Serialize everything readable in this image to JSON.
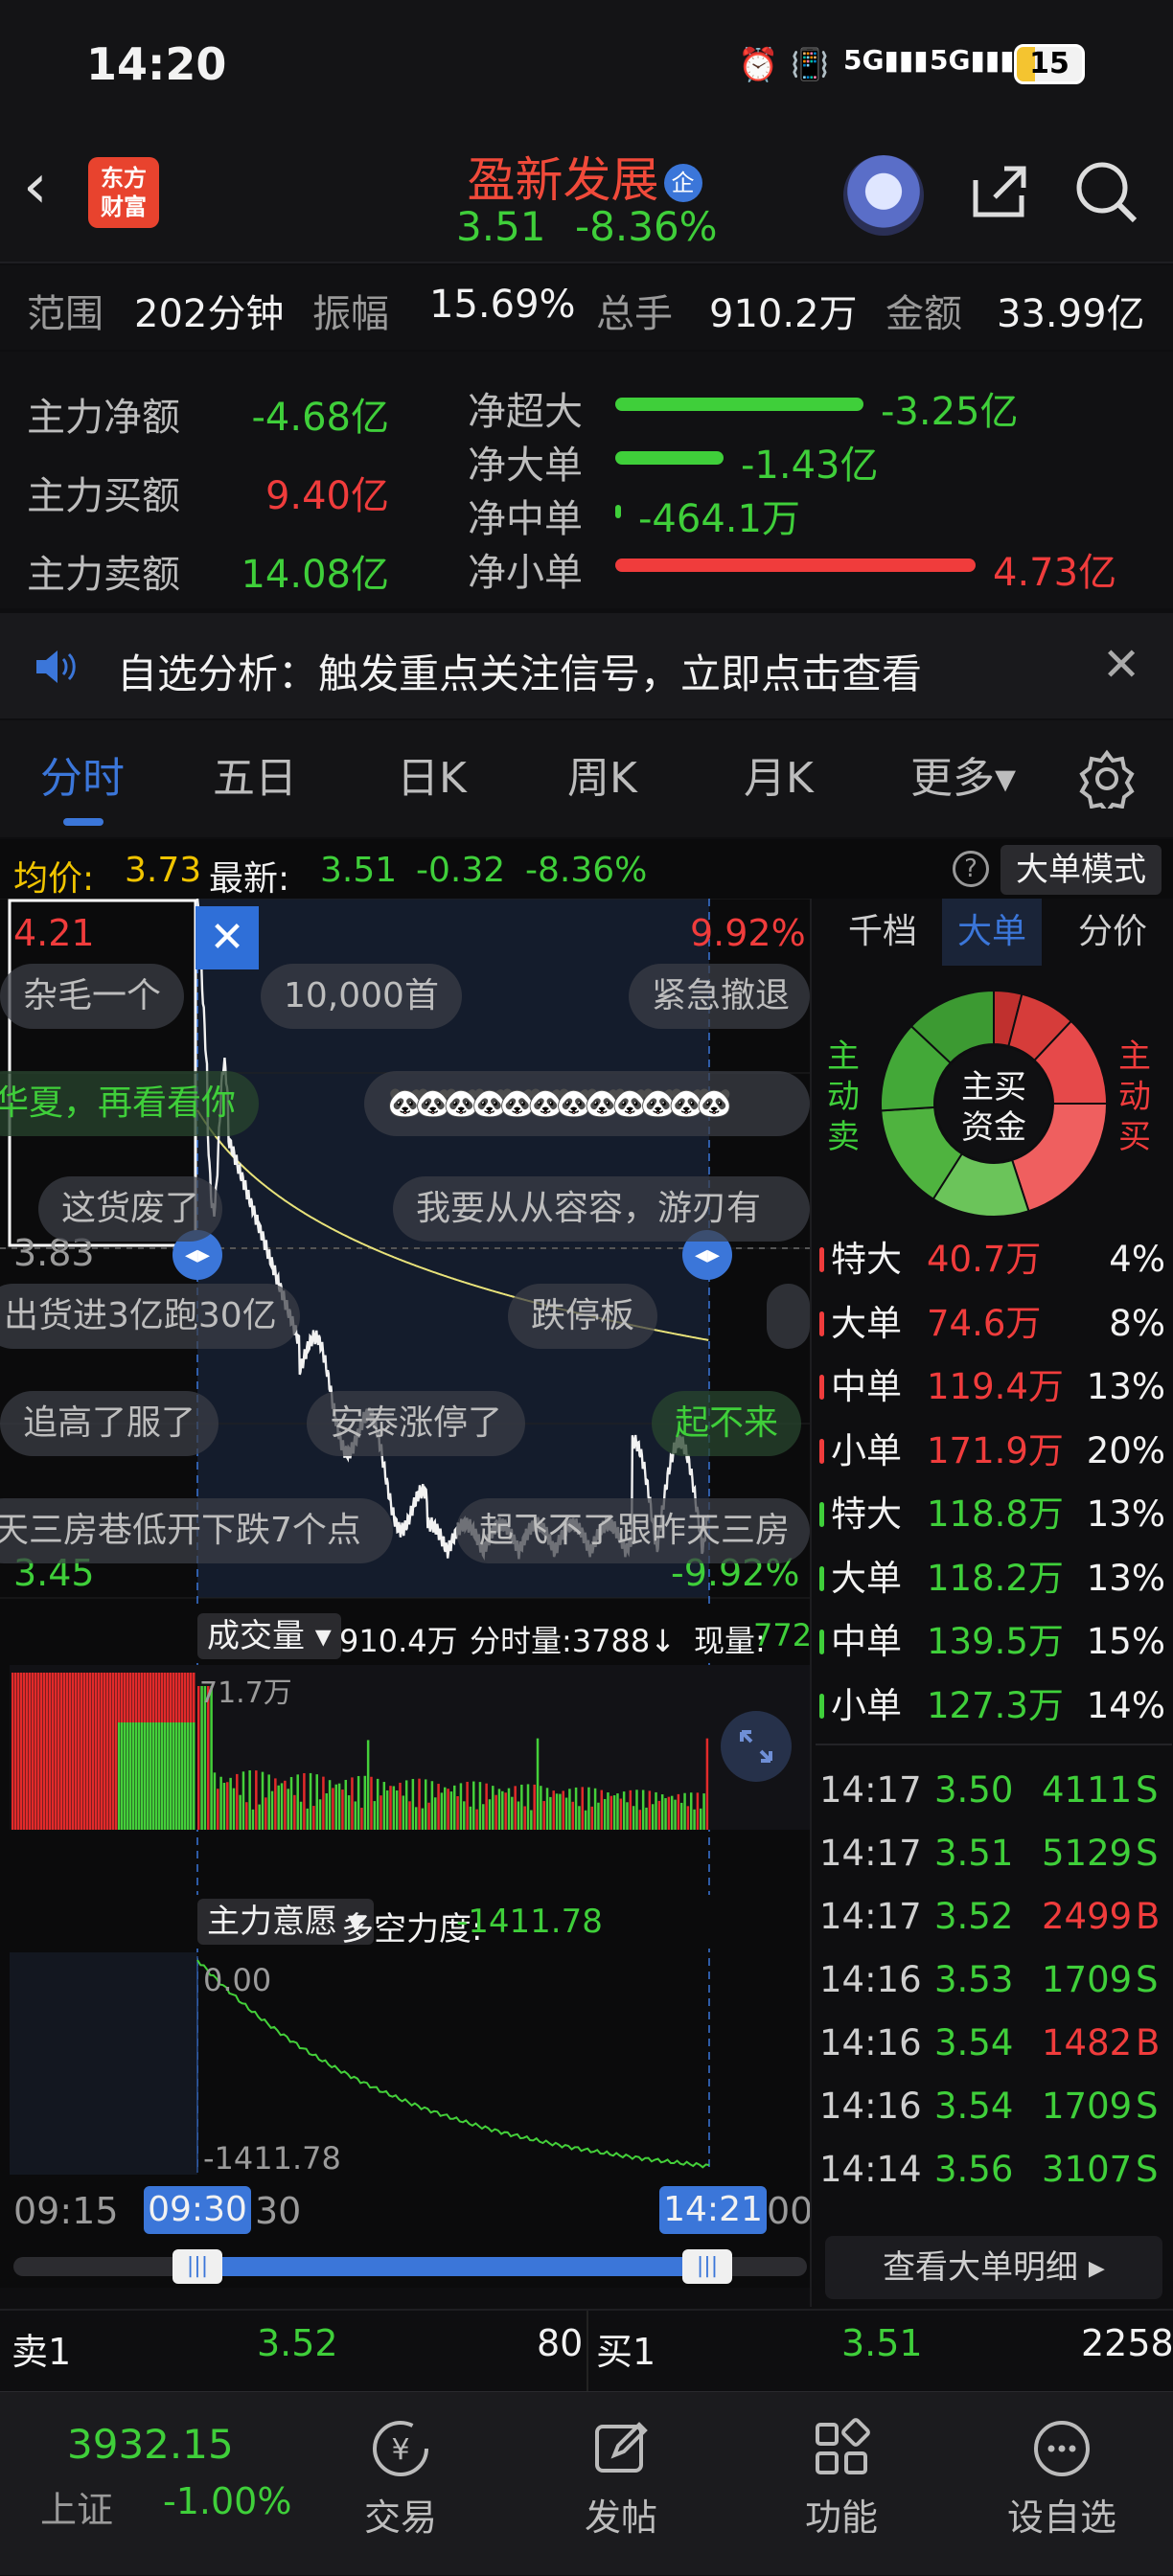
{
  "status": {
    "time": "14:20",
    "battery": "15",
    "signal1": "5G",
    "signal2": "5G"
  },
  "header": {
    "logo": "东方\n财富",
    "stock_name": "盈新发展",
    "badge": "企",
    "price": "3.51",
    "change_pct": "-8.36%"
  },
  "range": {
    "label_range": "范围",
    "value_range": "202分钟",
    "label_amp": "振幅",
    "value_amp": "15.69%",
    "label_vol": "总手",
    "value_vol": "910.2万",
    "label_amount": "金额",
    "value_amount": "33.99亿"
  },
  "fundflow": {
    "left": [
      {
        "label": "主力净额",
        "value": "-4.68亿",
        "color": "#3fcf3a"
      },
      {
        "label": "主力买额",
        "value": "9.40亿",
        "color": "#f03c3c"
      },
      {
        "label": "主力卖额",
        "value": "14.08亿",
        "color": "#3fcf3a"
      }
    ],
    "right": [
      {
        "label": "净超大",
        "value": "-3.25亿",
        "color": "#3fcf3a",
        "bar": 0.69
      },
      {
        "label": "净大单",
        "value": "-1.43亿",
        "color": "#3fcf3a",
        "bar": 0.3
      },
      {
        "label": "净中单",
        "value": "-464.1万",
        "color": "#3fcf3a",
        "bar": 0.01
      },
      {
        "label": "净小单",
        "value": "4.73亿",
        "color": "#f03c3c",
        "bar": 1.0
      }
    ]
  },
  "notice": {
    "text": "自选分析：触发重点关注信号，立即点击查看"
  },
  "tabs": {
    "items": [
      "分时",
      "五日",
      "日K",
      "周K",
      "月K",
      "更多▾"
    ],
    "active": 0
  },
  "chart_info": {
    "avg_label": "均价:",
    "avg_value": "3.73",
    "latest_label": "最新:",
    "latest_value": "3.51",
    "change": "-0.32",
    "change_pct": "-8.36%",
    "mode_button": "大单模式"
  },
  "price_chart": {
    "top_price": "4.21",
    "top_pct": "9.92%",
    "mid_price": "3.83",
    "bottom_price": "3.45",
    "bottom_pct": "-9.92%"
  },
  "danmu": [
    "杂毛一个",
    "10,000首",
    "紧急撤退",
    "华夏，再看看你",
    "🐼🐼🐼🐼🐼🐼🐼🐼🐼🐼🐼🐼",
    "这货废了",
    "我要从从容容，游刃有",
    "出货进3亿跑30亿",
    "跌停板",
    "追高了服了",
    "安泰涨停了",
    "起不来",
    "天三房巷低开下跌7个点",
    "起飞不了跟昨天三房"
  ],
  "volume_bar": {
    "label": "成交量",
    "total": "910.4万",
    "per_min": "分时量:3788↓",
    "now_label": "现量:",
    "now_value": "772",
    "max_label": "71.7万"
  },
  "intent_bar": {
    "label": "主力意愿",
    "force_label": "多空力度:",
    "force_value": "-1411.78",
    "top": "0.00",
    "bottom": "-1411.78"
  },
  "time_axis": {
    "start": "09:15",
    "open_marker": "09:30",
    "after_open": "30",
    "end_marker": "14:21",
    "end_suffix": "00"
  },
  "right_panel": {
    "tabs": [
      "千档",
      "大单",
      "分价"
    ],
    "active": 1,
    "donut_center": "主买\n资金",
    "left_label": "主\n动\n卖",
    "right_label": "主\n动\n买",
    "buy_rows": [
      {
        "label": "特大",
        "value": "40.7万",
        "pct": "4%"
      },
      {
        "label": "大单",
        "value": "74.6万",
        "pct": "8%"
      },
      {
        "label": "中单",
        "value": "119.4万",
        "pct": "13%"
      },
      {
        "label": "小单",
        "value": "171.9万",
        "pct": "20%"
      }
    ],
    "sell_rows": [
      {
        "label": "特大",
        "value": "118.8万",
        "pct": "13%"
      },
      {
        "label": "大单",
        "value": "118.2万",
        "pct": "13%"
      },
      {
        "label": "中单",
        "value": "139.5万",
        "pct": "15%"
      },
      {
        "label": "小单",
        "value": "127.3万",
        "pct": "14%"
      }
    ],
    "ticks": [
      {
        "time": "14:17",
        "price": "3.50",
        "vol": "4111",
        "side": "S"
      },
      {
        "time": "14:17",
        "price": "3.51",
        "vol": "5129",
        "side": "S"
      },
      {
        "time": "14:17",
        "price": "3.52",
        "vol": "2499",
        "side": "B"
      },
      {
        "time": "14:16",
        "price": "3.53",
        "vol": "1709",
        "side": "S"
      },
      {
        "time": "14:16",
        "price": "3.54",
        "vol": "1482",
        "side": "B"
      },
      {
        "time": "14:16",
        "price": "3.54",
        "vol": "1709",
        "side": "S"
      },
      {
        "time": "14:14",
        "price": "3.56",
        "vol": "3107",
        "side": "S"
      }
    ],
    "detail_button": "查看大单明细"
  },
  "orderbook": {
    "sell_label": "卖1",
    "sell_price": "3.52",
    "sell_vol": "80",
    "buy_label": "买1",
    "buy_price": "3.51",
    "buy_vol": "2258"
  },
  "bottom_nav": {
    "index_value": "3932.15",
    "index_name": "上证",
    "index_pct": "-1.00%",
    "items": [
      "交易",
      "发帖",
      "功能",
      "设自选"
    ]
  },
  "colors": {
    "red": "#f03c3c",
    "green": "#3fcf3a",
    "blue": "#3b76d9",
    "bg": "#0e0e10"
  }
}
